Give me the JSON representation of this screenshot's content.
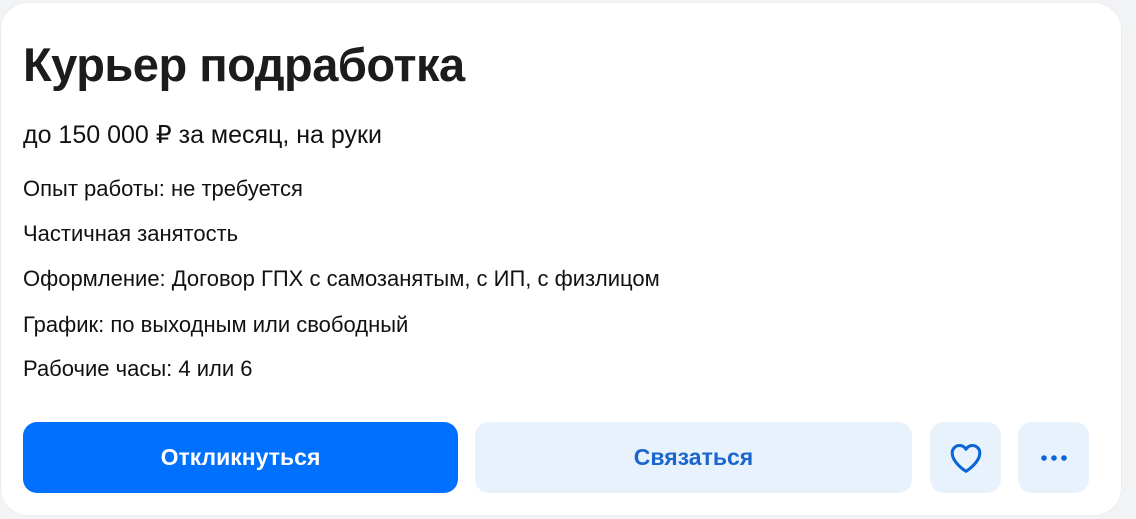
{
  "vacancy": {
    "title": "Курьер подработка",
    "salary": "до 150 000 ₽ за месяц, на руки",
    "details": [
      "Опыт работы: не требуется",
      "Частичная занятость",
      "Оформление:  Договор ГПХ с самозанятым, с ИП, с физлицом",
      "График: по выходным или свободный",
      "Рабочие часы: 4 или 6"
    ]
  },
  "actions": {
    "apply_label": "Откликнуться",
    "contact_label": "Связаться",
    "favorite_icon": "heart-icon",
    "more_icon": "more-horizontal-icon"
  },
  "colors": {
    "primary": "#0070ff",
    "secondary_bg": "#e8f2fd",
    "secondary_text": "#1a66cc"
  }
}
